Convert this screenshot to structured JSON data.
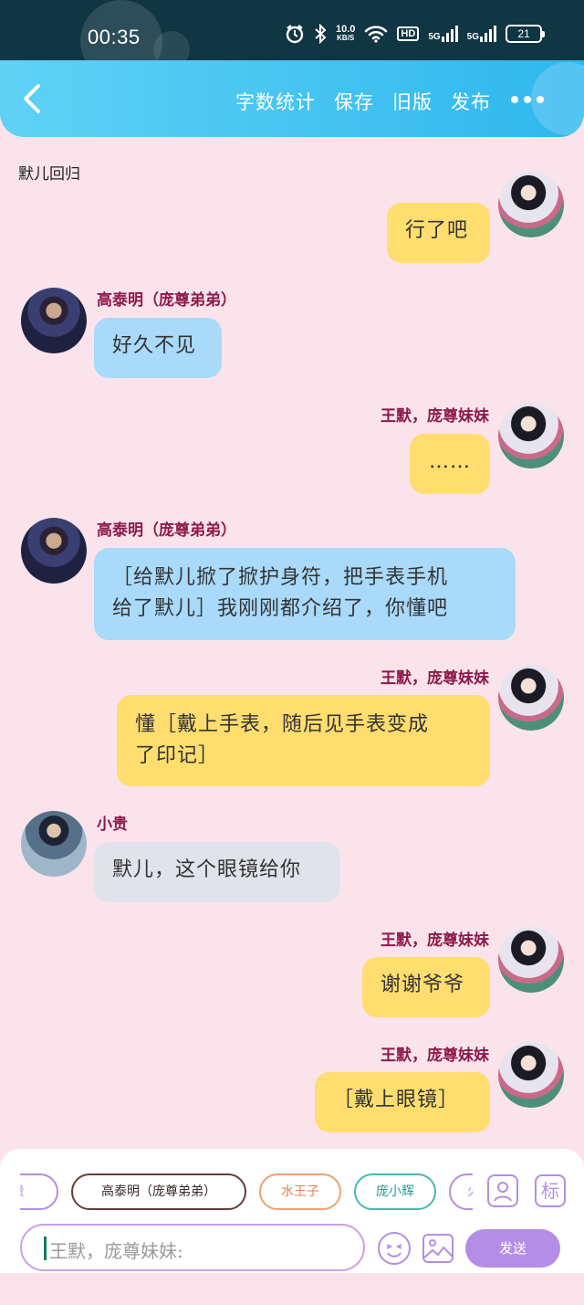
{
  "status_bar": {
    "time": "00:35",
    "net_speed_value": "10.0",
    "net_speed_unit": "KB/S",
    "hd_label": "HD",
    "sim1_label": "5G",
    "sim2_label": "5G",
    "battery": "21"
  },
  "header": {
    "actions": [
      "字数统计",
      "保存",
      "旧版",
      "发布"
    ],
    "accent_color": "#2fb7ee"
  },
  "document": {
    "title": "默儿回归"
  },
  "messages": [
    {
      "side": "right",
      "speaker": "",
      "text": "行了吧",
      "color": "#ffdd6f"
    },
    {
      "side": "left",
      "speaker": "高泰明（庞尊弟弟）",
      "text": "好久不见",
      "color": "#a9dafa"
    },
    {
      "side": "right",
      "speaker": "王默，庞尊妹妹",
      "text": "……",
      "color": "#ffdd6f"
    },
    {
      "side": "left",
      "speaker": "高泰明（庞尊弟弟）",
      "text": "［给默儿掀了掀护身符，把手表手机给了默儿］我刚刚都介绍了，你懂吧",
      "line1": "［给默儿掀了掀护身符，把手表手机",
      "line2": "给了默儿］我刚刚都介绍了，你懂吧",
      "color": "#a9dafa"
    },
    {
      "side": "right",
      "speaker": "王默，庞尊妹妹",
      "text": "懂［戴上手表，随后见手表变成了印记］",
      "line1": "懂［戴上手表，随后见手表变成",
      "line2": "了印记］",
      "color": "#ffdd6f"
    },
    {
      "side": "left",
      "speaker": "小贵",
      "text": "默儿，这个眼镜给你",
      "color": "#e1e3ea"
    },
    {
      "side": "right",
      "speaker": "王默，庞尊妹妹",
      "text": "谢谢爷爷",
      "color": "#ffdd6f"
    },
    {
      "side": "right",
      "speaker": "王默，庞尊妹妹",
      "text": "［戴上眼镜］",
      "color": "#ffdd6f"
    }
  ],
  "characters": [
    {
      "label": "小贵",
      "color": "#b48ee0"
    },
    {
      "label": "高泰明（庞尊弟弟）",
      "color": "#6b3a3a"
    },
    {
      "label": "水王子",
      "color": "#f0a070"
    },
    {
      "label": "庞小辉",
      "color": "#4ab8b0"
    },
    {
      "label": "火",
      "color": "#b48ee0"
    }
  ],
  "tools": {
    "tag_label": "标"
  },
  "composer": {
    "placeholder": "王默，庞尊妹妹:",
    "send_label": "发送"
  }
}
